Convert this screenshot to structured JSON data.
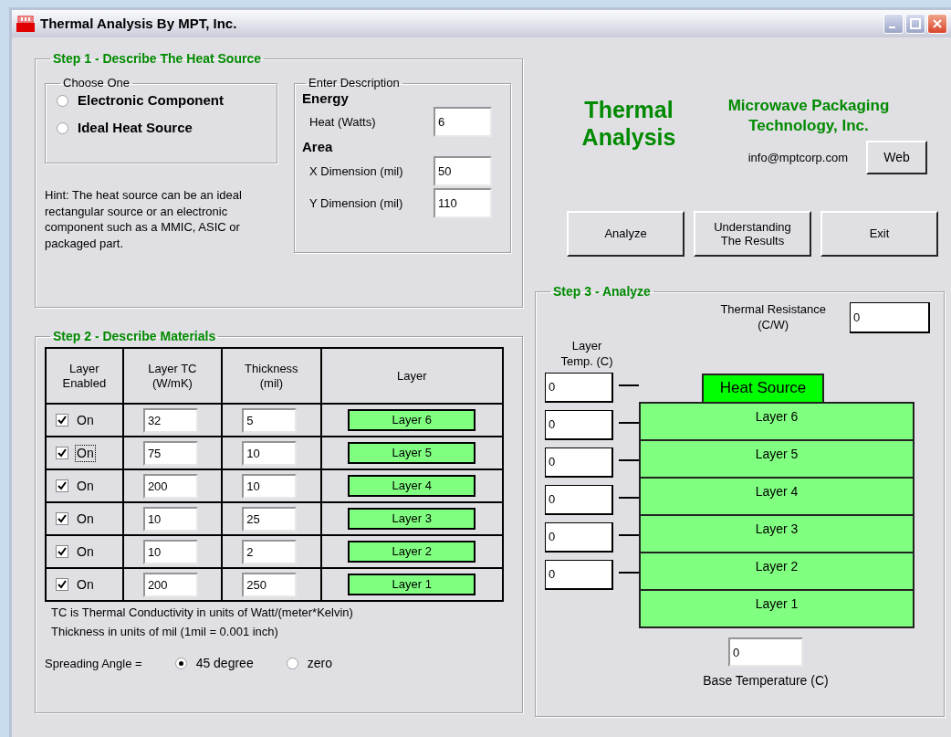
{
  "window": {
    "title": "Thermal Analysis By MPT, Inc."
  },
  "step1": {
    "title": "Step 1 - Describe The Heat Source",
    "choose": {
      "title": "Choose One",
      "options": [
        {
          "label": "Electronic Component",
          "selected": false
        },
        {
          "label": "Ideal Heat Source",
          "selected": false
        }
      ]
    },
    "hint": "Hint: The heat source can be an ideal rectangular source or an electronic component such as a MMIC, ASIC or packaged part.",
    "description": {
      "title": "Enter Description",
      "sections": [
        {
          "heading": "Energy",
          "fields": [
            {
              "label": "Heat (Watts)",
              "value": "6"
            }
          ]
        },
        {
          "heading": "Area",
          "fields": [
            {
              "label": "X Dimension (mil)",
              "value": "50"
            },
            {
              "label": "Y Dimension (mil)",
              "value": "110"
            }
          ]
        }
      ]
    }
  },
  "header": {
    "title": "Thermal\nAnalysis",
    "company": "Microwave Packaging\nTechnology, Inc.",
    "email": "info@mptcorp.com",
    "web_button": "Web"
  },
  "actions": [
    "Analyze",
    "Understanding\nThe Results",
    "Exit"
  ],
  "step2": {
    "title": "Step 2 - Describe Materials",
    "columns": [
      "Layer\nEnabled",
      "Layer TC\n(W/mK)",
      "Thickness\n(mil)",
      "Layer"
    ],
    "rows": [
      {
        "enabled": true,
        "label": "On",
        "focused": false,
        "tc": "32",
        "thickness": "5",
        "layer": "Layer 6"
      },
      {
        "enabled": true,
        "label": "On",
        "focused": true,
        "tc": "75",
        "thickness": "10",
        "layer": "Layer 5"
      },
      {
        "enabled": true,
        "label": "On",
        "focused": false,
        "tc": "200",
        "thickness": "10",
        "layer": "Layer 4"
      },
      {
        "enabled": true,
        "label": "On",
        "focused": false,
        "tc": "10",
        "thickness": "25",
        "layer": "Layer 3"
      },
      {
        "enabled": true,
        "label": "On",
        "focused": false,
        "tc": "10",
        "thickness": "2",
        "layer": "Layer 2"
      },
      {
        "enabled": true,
        "label": "On",
        "focused": false,
        "tc": "200",
        "thickness": "250",
        "layer": "Layer 1"
      }
    ],
    "notes": [
      "TC is Thermal Conductivity in units of Watt/(meter*Kelvin)",
      "Thickness in units of mil (1mil = 0.001 inch)"
    ],
    "spreading": {
      "label": "Spreading Angle =",
      "options": [
        {
          "label": "45 degree",
          "selected": true
        },
        {
          "label": "zero",
          "selected": false
        }
      ]
    }
  },
  "step3": {
    "title": "Step 3 - Analyze",
    "resistance": {
      "label": "Thermal Resistance\n(C/W)",
      "value": "0"
    },
    "temps_label": "Layer\nTemp. (C)",
    "temps": [
      "0",
      "0",
      "0",
      "0",
      "0",
      "0"
    ],
    "heat_source": "Heat Source",
    "stack": [
      "Layer 6",
      "Layer 5",
      "Layer 4",
      "Layer 3",
      "Layer 2",
      "Layer 1"
    ],
    "base": {
      "label": "Base Temperature (C)",
      "value": "0"
    }
  }
}
